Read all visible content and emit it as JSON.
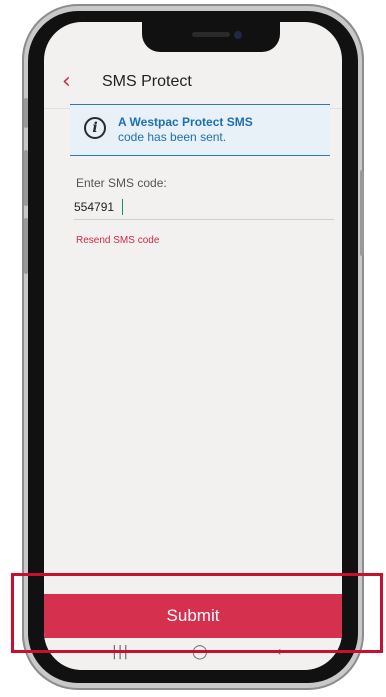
{
  "appbar": {
    "back_icon": "chevron-left-icon",
    "title": "SMS Protect"
  },
  "info": {
    "icon": "info-icon",
    "title": "A Westpac Protect SMS",
    "subtitle": "code has been sent."
  },
  "form": {
    "label": "Enter SMS code:",
    "value": "554791",
    "resend_label": "Resend SMS code"
  },
  "submit_label": "Submit",
  "navbar": {
    "recent": "|||",
    "home": "◯",
    "back": "‹"
  },
  "colors": {
    "accent": "#d6304f",
    "info": "#1f6fae",
    "highlight": "#c8102e"
  }
}
